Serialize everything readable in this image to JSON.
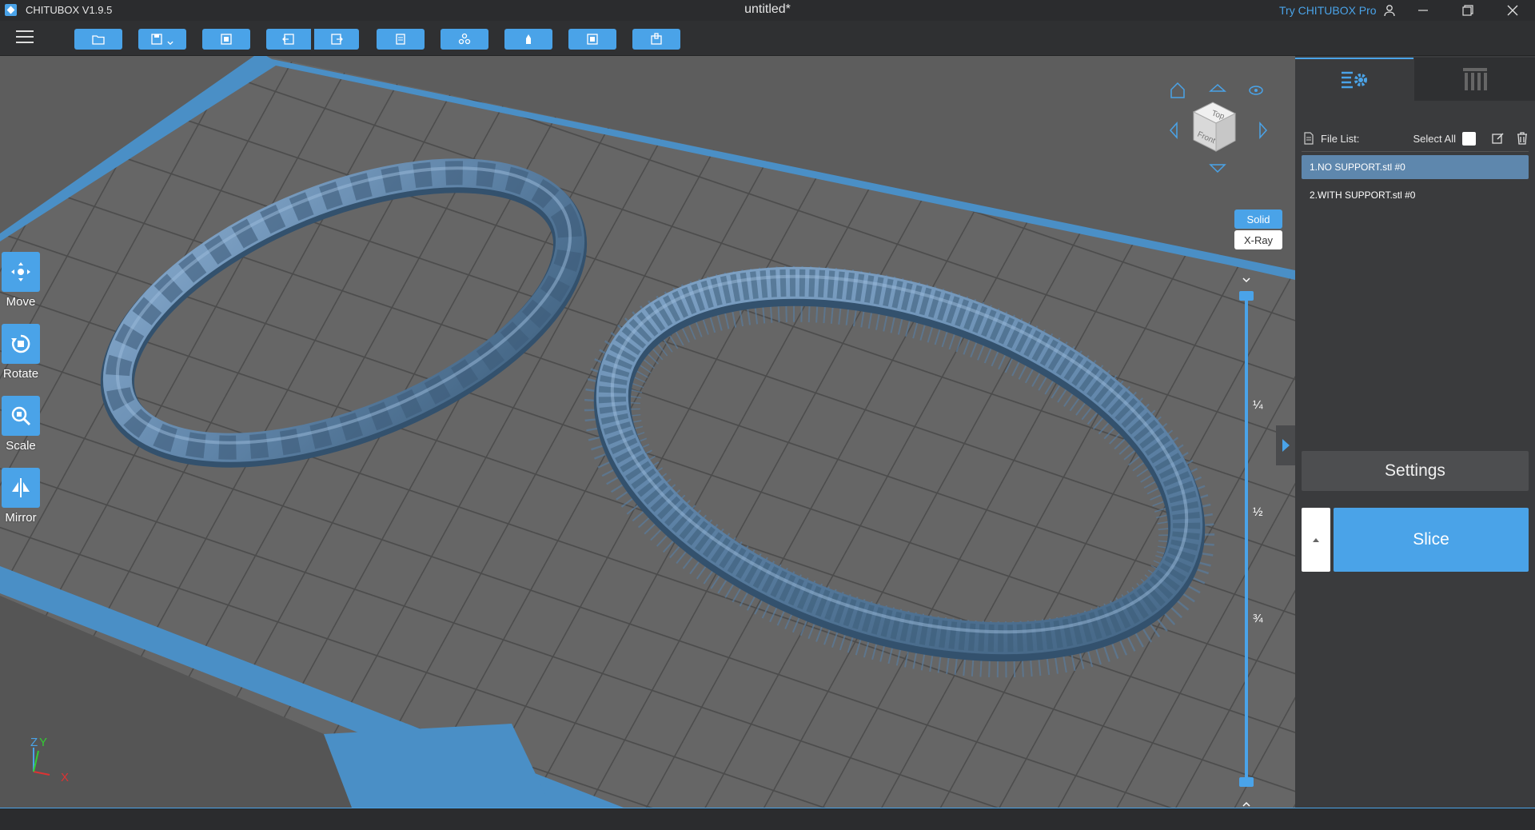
{
  "titlebar": {
    "app_name": "CHITUBOX V1.9.5",
    "doc_title": "untitled*",
    "try_pro": "Try CHITUBOX Pro"
  },
  "toolbar": {
    "buttons": [
      "open-file",
      "save",
      "auto-layout",
      "undo",
      "redo",
      "copy",
      "multi-copy",
      "center",
      "fit",
      "hollow"
    ]
  },
  "left_tools": {
    "move": "Move",
    "rotate": "Rotate",
    "scale": "Scale",
    "mirror": "Mirror"
  },
  "view_modes": {
    "solid": "Solid",
    "xray": "X-Ray"
  },
  "view_cube": {
    "top": "Top",
    "front": "Front"
  },
  "layer_slider": {
    "q1": "¼",
    "q2": "½",
    "q3": "¾"
  },
  "axes": {
    "x": "X",
    "y": "Y",
    "z": "Z"
  },
  "panel": {
    "file_list_label": "File List:",
    "select_all_label": "Select All",
    "files": [
      "1.NO SUPPORT.stl #0",
      "2.WITH SUPPORT.stl #0"
    ],
    "settings_label": "Settings",
    "slice_label": "Slice"
  },
  "colors": {
    "accent": "#4aa3e8",
    "model": "#5f84a8",
    "plate": "#636363"
  }
}
